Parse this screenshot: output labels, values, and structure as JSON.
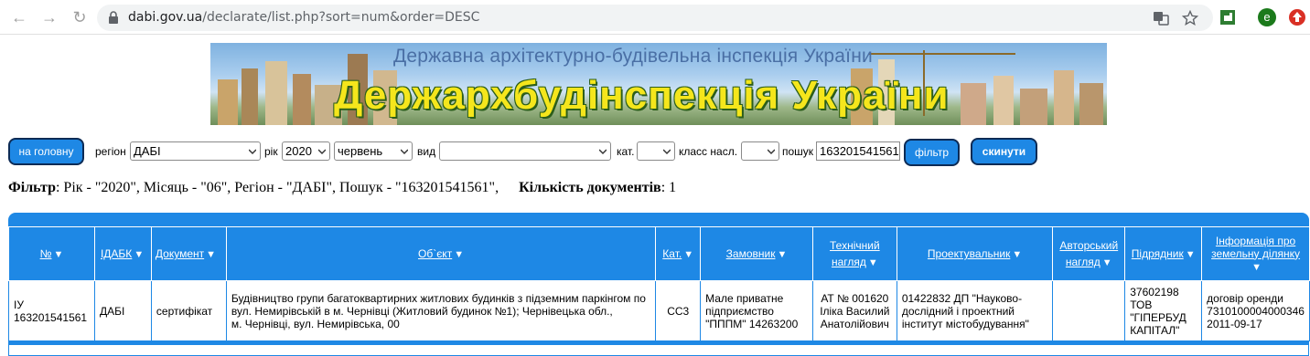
{
  "browser": {
    "url_host": "dabi.gov.ua",
    "url_path": "/declarate/list.php?sort=num&order=DESC",
    "profile_initial": "e"
  },
  "banner": {
    "subtitle": "Державна архітектурно-будівельна інспекція України",
    "title": "Держархбудінспекція України"
  },
  "controls": {
    "home_button": "на головну",
    "region_label": "регіон",
    "region_value": "ДАБІ",
    "year_label": "рік",
    "year_value": "2020",
    "month_value": "червень",
    "type_label": "вид",
    "type_value": "",
    "cat_label": "кат.",
    "cat_value": "",
    "class_label": "класс насл.",
    "class_value": "",
    "search_label": "пошук",
    "search_value": "163201541561",
    "filter_button": "фільтр",
    "reset_button": "скинути"
  },
  "summary": {
    "filter_label": "Фільтр",
    "filter_text": ": Рік - \"2020\", Місяць - \"06\", Регіон - \"ДАБІ\", Пошук - \"163201541561\",",
    "count_label": "Кількість документів",
    "count_text": ": 1"
  },
  "table": {
    "headers": {
      "num": "№",
      "idabk": "ІДАБК",
      "doc": "Документ",
      "object": "Об`єкт",
      "cat": "Кат.",
      "customer": "Замовник",
      "tech1": "Технічний",
      "tech2": "нагляд",
      "designer": "Проектувальник",
      "author1": "Авторський",
      "author2": "нагляд",
      "contractor": "Підрядник",
      "land1": "Інформація про",
      "land2": "земельну ділянку"
    },
    "row": {
      "num1": "ІУ",
      "num2": "163201541561",
      "idabk": "ДАБІ",
      "doc": "сертифікат",
      "object1": "Будівництво групи багатоквартирних житлових будинків з підземним паркінгом по",
      "object2": "вул. Немирівській в м. Чернівці (Житловий будинок №1); Чернівецька обл.,",
      "object3": "м. Чернівці, вул. Немирівська, 00",
      "cat": "СС3",
      "customer1": "Мале приватне",
      "customer2": "підприємство",
      "customer3": "\"ПППМ\" 14263200",
      "tech1": "АТ № 001620",
      "tech2": "Іліка Василий",
      "tech3": "Анатолійович",
      "designer1": "01422832 ДП \"Науково-",
      "designer2": "дослідний і проектний",
      "designer3": "інститут містобудування\"",
      "author": "",
      "contractor1": "37602198",
      "contractor2": "ТОВ",
      "contractor3": "\"ГІПЕРБУД",
      "contractor4": "КАПІТАЛ\"",
      "land1": "договір оренди",
      "land2": "7310100004000346",
      "land3": "2011-09-17"
    }
  },
  "colors": {
    "accent": "#1e88e5",
    "button_border": "#0d2b55",
    "banner_title": "#f5e61c"
  }
}
